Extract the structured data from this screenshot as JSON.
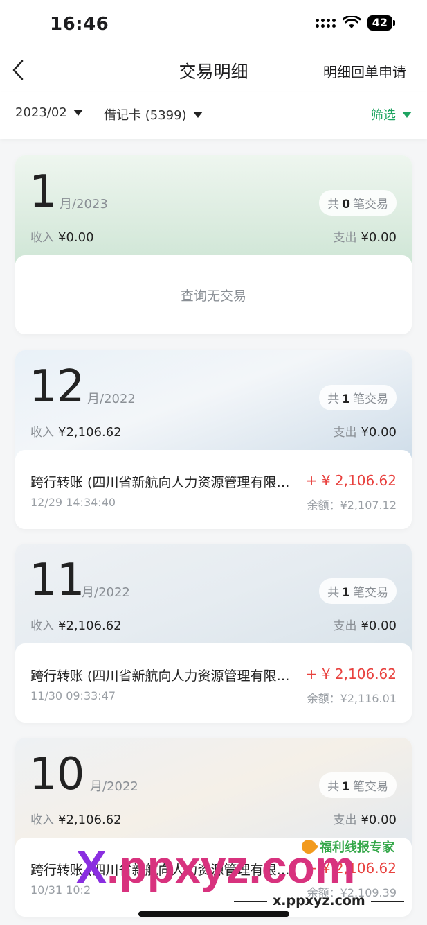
{
  "status": {
    "time": "16:46",
    "battery": "42"
  },
  "nav": {
    "title": "交易明细",
    "action": "明细回单申请"
  },
  "filters": {
    "period": "2023/02",
    "card": "借记卡 (5399)",
    "screen": "筛选"
  },
  "months": [
    {
      "month": "1",
      "year": "月/2023",
      "count_prefix": "共",
      "count": "0",
      "count_suffix": "笔交易",
      "income_label": "收入",
      "income": "¥0.00",
      "expense_label": "支出",
      "expense": "¥0.00",
      "empty_text": "查询无交易"
    },
    {
      "month": "12",
      "year": "月/2022",
      "count_prefix": "共",
      "count": "1",
      "count_suffix": "笔交易",
      "income_label": "收入",
      "income": "¥2,106.62",
      "expense_label": "支出",
      "expense": "¥0.00",
      "txn": {
        "name": "跨行转账 (四川省新航向人力资源管理有限公司)",
        "time": "12/29  14:34:40",
        "amount": "+ ¥ 2,106.62",
        "balance": "余额：¥2,107.12"
      }
    },
    {
      "month": "11",
      "year": "月/2022",
      "count_prefix": "共",
      "count": "1",
      "count_suffix": "笔交易",
      "income_label": "收入",
      "income": "¥2,106.62",
      "expense_label": "支出",
      "expense": "¥0.00",
      "txn": {
        "name": "跨行转账 (四川省新航向人力资源管理有限公司)",
        "time": "11/30  09:33:47",
        "amount": "+ ¥ 2,106.62",
        "balance": "余额：¥2,116.01"
      }
    },
    {
      "month": "10",
      "year": "月/2022",
      "count_prefix": "共",
      "count": "1",
      "count_suffix": "笔交易",
      "income_label": "收入",
      "income": "¥2,106.62",
      "expense_label": "支出",
      "expense": "¥0.00",
      "txn": {
        "name": "跨行转账 (四川省新航向人力资源管理有限公司)",
        "time": "10/31  10:2",
        "amount": "+ ¥ 2,106.62",
        "balance": "余额：¥2,109.39"
      }
    }
  ],
  "watermark": {
    "big_x": "X",
    "big_rest": ".ppxyz.com",
    "small": "x.ppxyz.com",
    "top": "福利线报专家"
  }
}
